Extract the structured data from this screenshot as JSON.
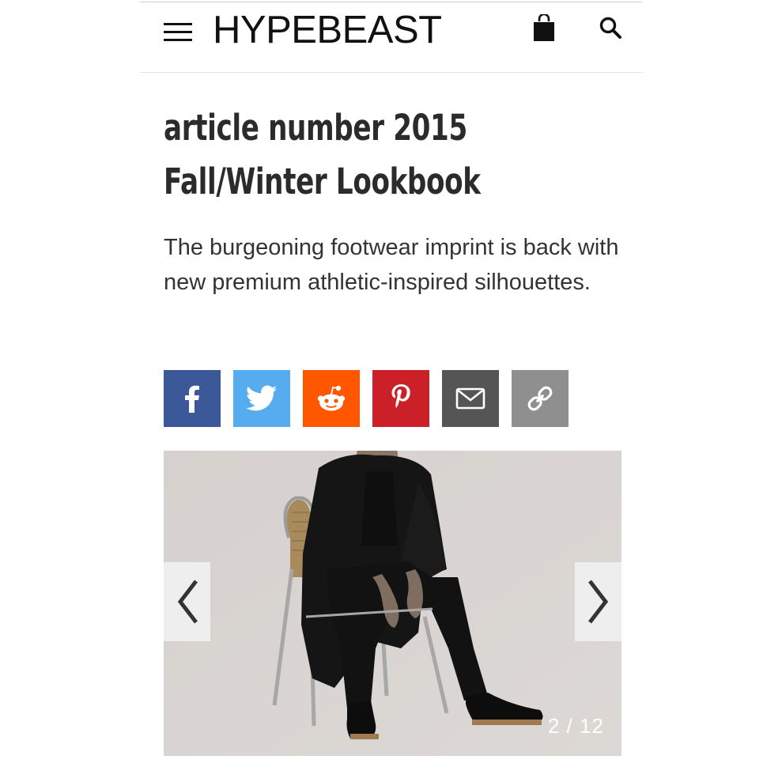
{
  "header": {
    "logo_text": "HYPEBEAST",
    "menu_icon": "hamburger-menu-icon",
    "bag_icon": "shopping-bag-icon",
    "search_icon": "search-icon"
  },
  "article": {
    "title_line1": "article number 2015",
    "title_line2": "Fall/Winter Lookbook",
    "subtitle": "The burgeoning footwear imprint is back with new premium athletic-inspired silhouettes."
  },
  "share": {
    "buttons": [
      {
        "icon": "facebook-icon",
        "color": "#3b5998"
      },
      {
        "icon": "twitter-icon",
        "color": "#55acee"
      },
      {
        "icon": "reddit-icon",
        "color": "#ff5700"
      },
      {
        "icon": "pinterest-icon",
        "color": "#cb2027"
      },
      {
        "icon": "email-icon",
        "color": "#555555"
      },
      {
        "icon": "link-icon",
        "color": "#8f8f8f"
      }
    ]
  },
  "gallery": {
    "counter": "2 / 12",
    "prev_icon": "chevron-left-icon",
    "next_icon": "chevron-right-icon"
  },
  "colors": {
    "text": "#2b2b2b",
    "background": "#ffffff",
    "divider": "#e3e3e3",
    "photo_background": "#d9d5d2"
  }
}
